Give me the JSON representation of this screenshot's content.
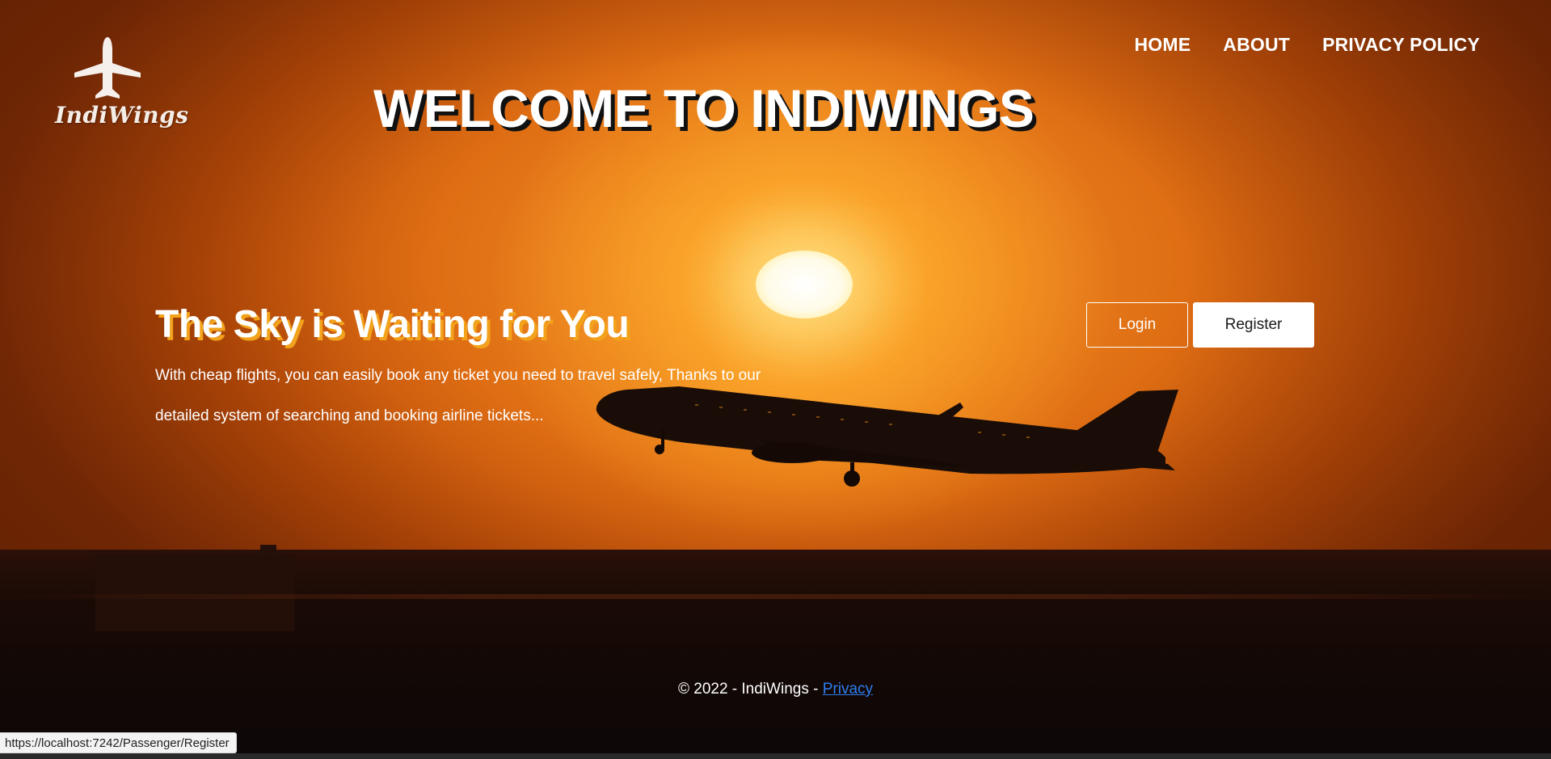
{
  "brand": {
    "logo_text": "IndiWings",
    "logo_icon": "airplane-icon"
  },
  "nav": {
    "items": [
      {
        "label": "HOME"
      },
      {
        "label": "ABOUT"
      },
      {
        "label": "PRIVACY POLICY"
      }
    ]
  },
  "welcome": {
    "title": "WELCOME TO INDIWINGS"
  },
  "hero": {
    "title": "The Sky is Waiting for You",
    "description": "With cheap flights, you can easily book any ticket you need to travel safely, Thanks to our detailed system of searching and booking airline tickets..."
  },
  "actions": {
    "login_label": "Login",
    "register_label": "Register"
  },
  "footer": {
    "copyright": "© 2022 - IndiWings - ",
    "privacy_link": "Privacy"
  },
  "status_bar": {
    "url": "https://localhost:7242/Passenger/Register"
  },
  "colors": {
    "title_shadow": "#111111",
    "hero_title_shadow": "#f2a21b",
    "link": "#2f7ef0",
    "sky_primary": "#e06f14"
  }
}
